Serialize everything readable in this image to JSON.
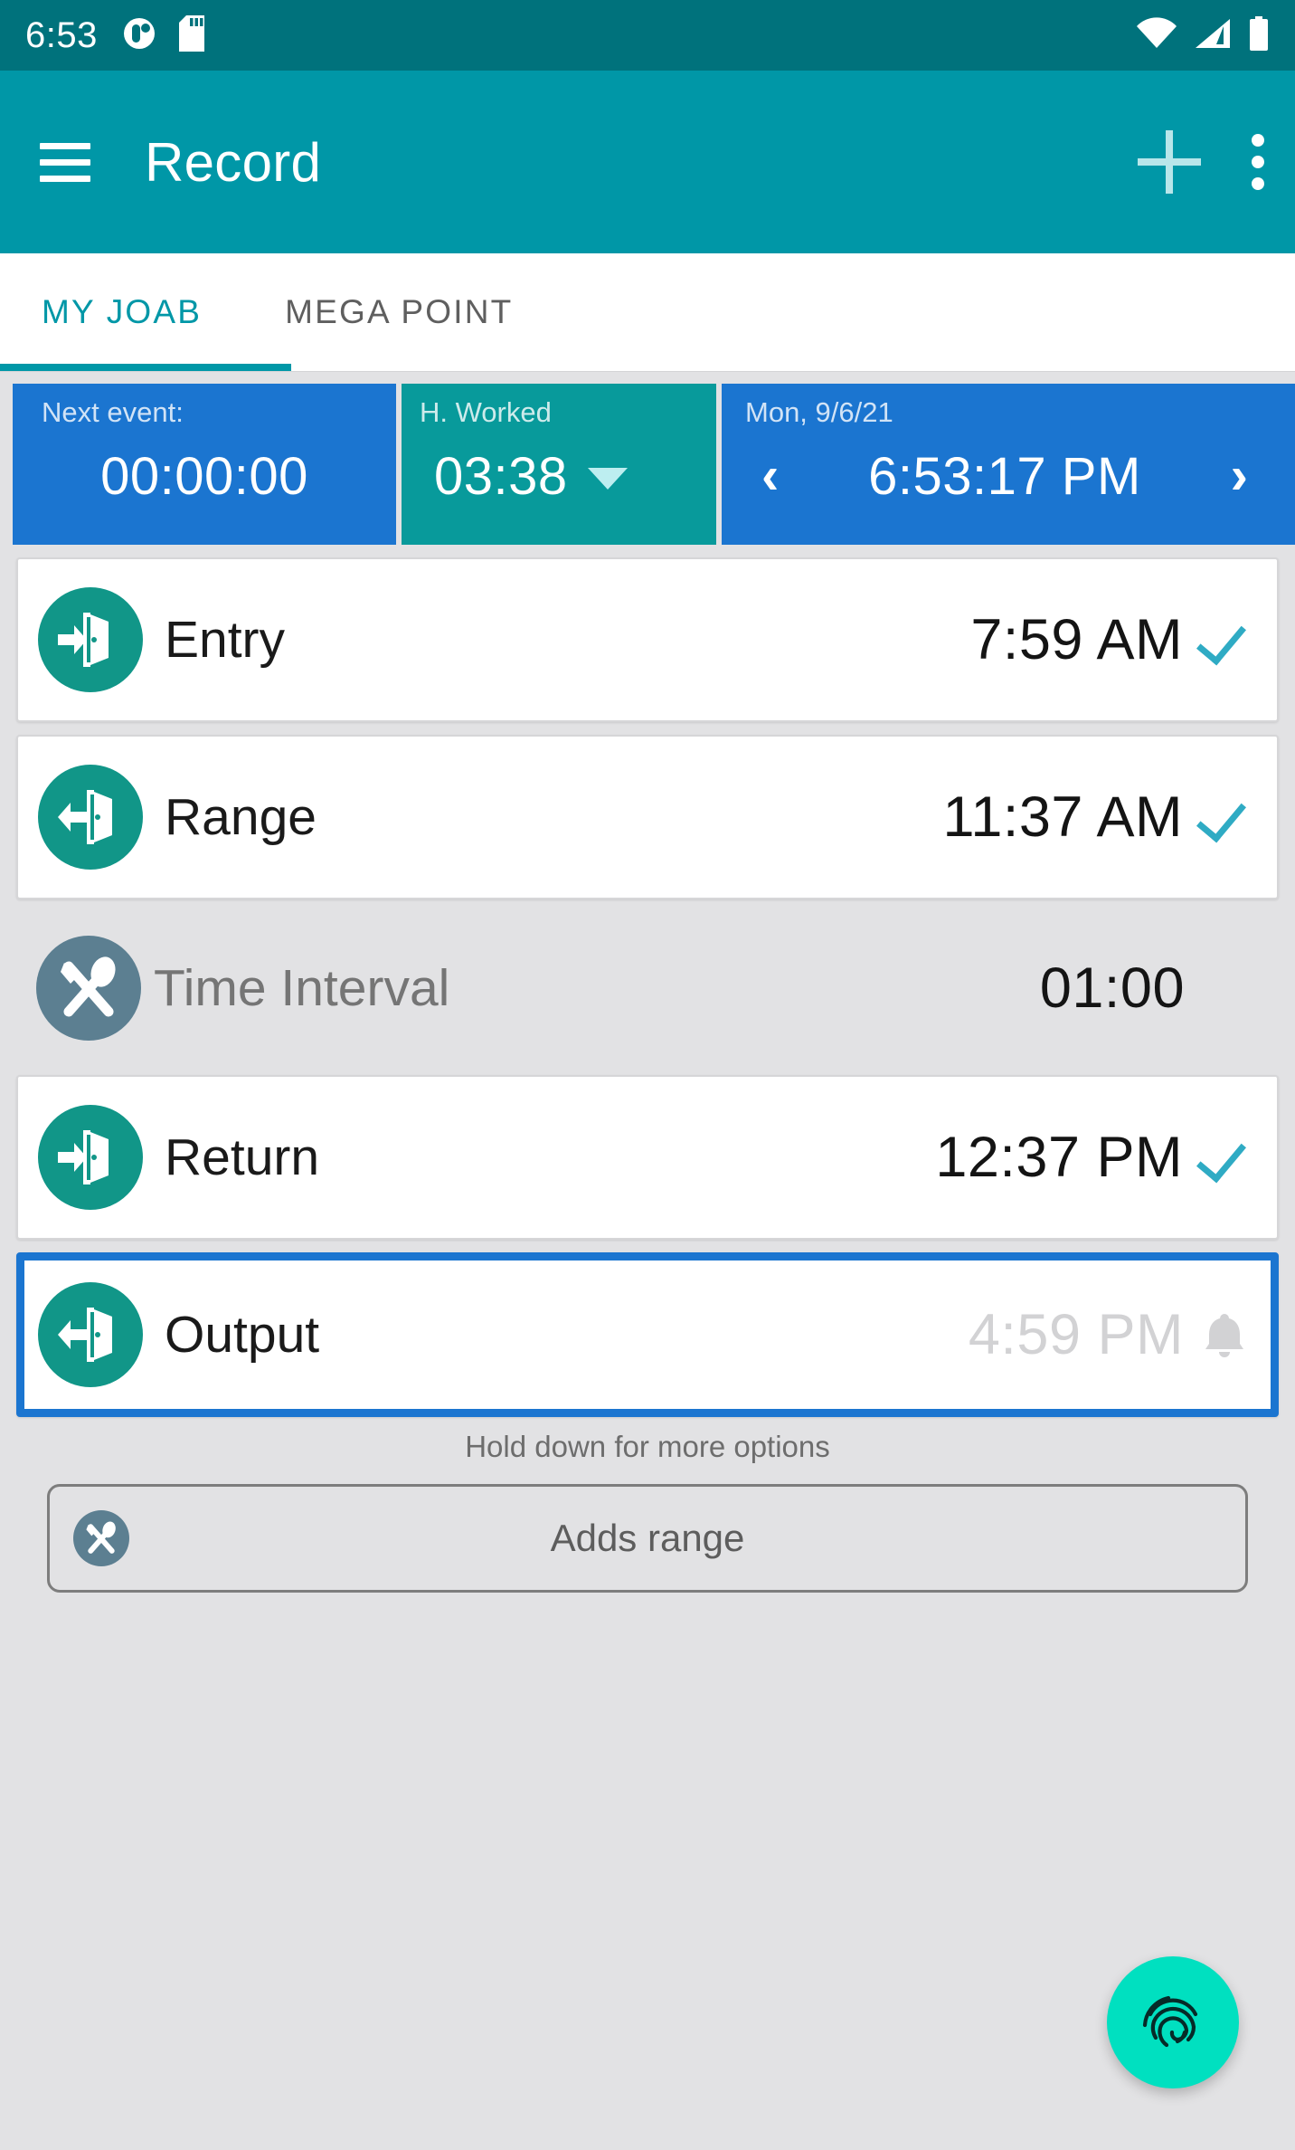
{
  "status_bar": {
    "time": "6:53",
    "icons": [
      "app-notification-icon",
      "sd-card-icon",
      "wifi-icon",
      "cellular-signal-icon",
      "battery-icon"
    ]
  },
  "app_bar": {
    "menu_icon": "hamburger-menu-icon",
    "title": "Record",
    "add_icon": "plus-icon",
    "overflow_icon": "more-vertical-icon"
  },
  "tabs": [
    {
      "label": "MY JOAB",
      "active": true
    },
    {
      "label": "MEGA POINT",
      "active": false
    }
  ],
  "info_bar": {
    "next_event": {
      "label": "Next event:",
      "value": "00:00:00"
    },
    "hours_worked": {
      "label": "H. Worked",
      "value": "03:38",
      "chevron": "chevron-down-icon"
    },
    "date_time": {
      "date": "Mon, 9/6/21",
      "time": "6:53:17 PM",
      "prev": "‹",
      "next": "›"
    }
  },
  "records": [
    {
      "label": "Entry",
      "time": "7:59 AM",
      "icon": "door-enter-icon",
      "icon_style": "teal",
      "status": "checked",
      "selected": false,
      "flat": false
    },
    {
      "label": "Range",
      "time": "11:37 AM",
      "icon": "door-exit-icon",
      "icon_style": "teal",
      "status": "checked",
      "selected": false,
      "flat": false
    },
    {
      "label": "Time Interval",
      "time": "01:00",
      "icon": "meal-break-icon",
      "icon_style": "slate",
      "status": "none",
      "selected": false,
      "flat": true
    },
    {
      "label": "Return",
      "time": "12:37 PM",
      "icon": "door-enter-icon",
      "icon_style": "teal",
      "status": "checked",
      "selected": false,
      "flat": false
    },
    {
      "label": "Output",
      "time": "4:59 PM",
      "icon": "door-exit-icon",
      "icon_style": "teal",
      "status": "alarm",
      "selected": true,
      "flat": false
    }
  ],
  "hint_text": "Hold down for more options",
  "adds_range": {
    "label": "Adds range",
    "icon": "meal-break-icon"
  },
  "fab": {
    "icon": "fingerprint-icon"
  },
  "colors": {
    "status_bar_bg": "#00727c",
    "app_bar_bg": "#0097a7",
    "accent_teal": "#0097a7",
    "panel_blue": "#1b75d0",
    "panel_teal": "#089a9b",
    "icon_teal": "#119688",
    "icon_slate": "#5c7f91",
    "check_teal": "#2fabc4",
    "fab_bg": "#00e0c0",
    "selection_border": "#1b75d0",
    "page_bg": "#e2e2e4"
  }
}
